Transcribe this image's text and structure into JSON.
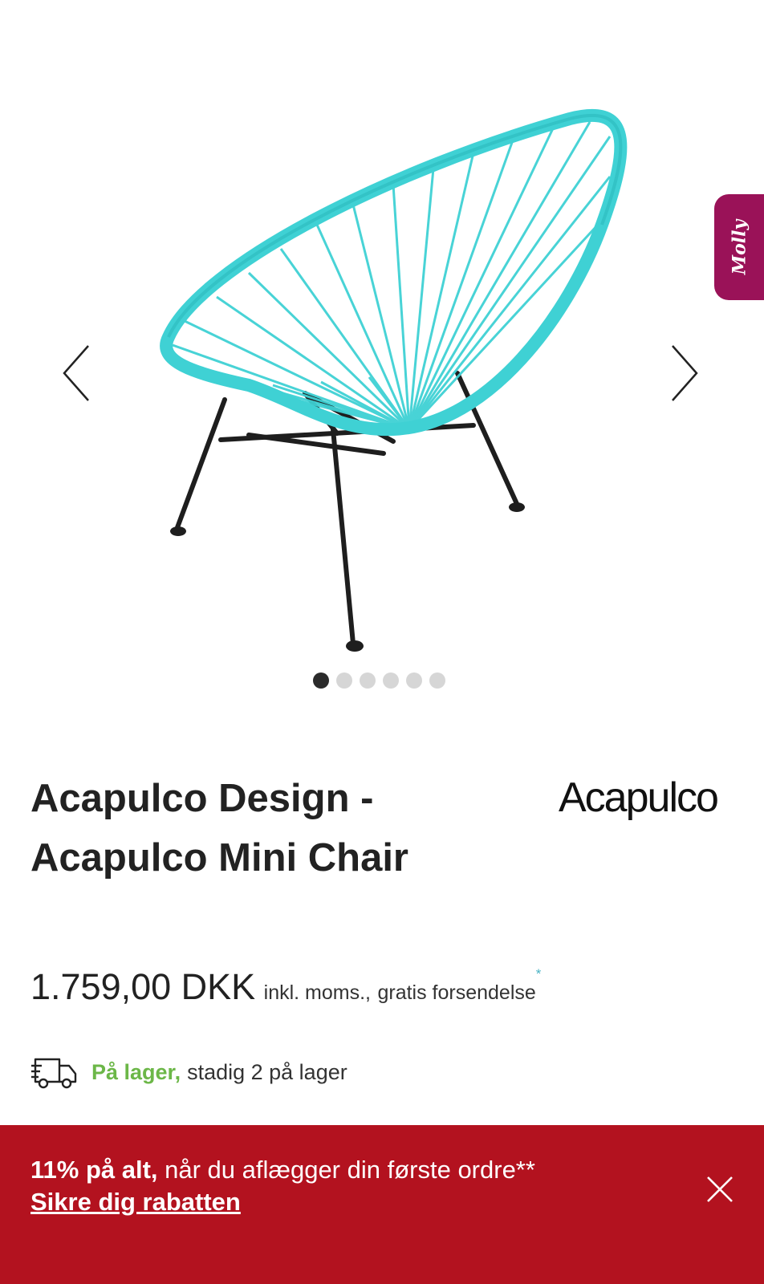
{
  "gallery": {
    "prev_icon": "chevron-left-icon",
    "next_icon": "chevron-right-icon",
    "slide_count": 6,
    "active_slide": 1
  },
  "assistant_tab": {
    "label": "Molly",
    "color": "#9a1258"
  },
  "product": {
    "title_line1": "Acapulco Design -",
    "title_line2": "Acapulco Mini Chair",
    "brand_logo": "Acapulco",
    "price": "1.759,00 DKK",
    "vat_note": "inkl. moms.,",
    "shipping_note": "gratis forsendelse",
    "shipping_marker": "*",
    "stock_label": "På lager,",
    "stock_info": "stadig 2 på lager",
    "stock_color": "#6cb748",
    "chair_color": "#3fd1d4"
  },
  "promo": {
    "highlight": "11% på alt,",
    "text": " når du aflægger din første ordre**",
    "link": "Sikre dig rabatten",
    "background": "#b3121f",
    "close_icon": "close-icon"
  }
}
